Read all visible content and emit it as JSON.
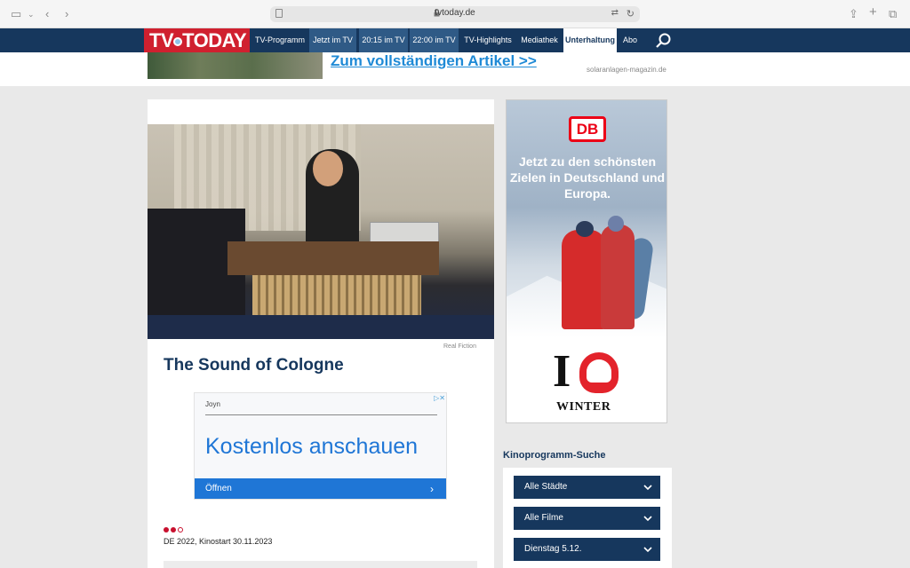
{
  "browser": {
    "url": "tvtoday.de"
  },
  "site": {
    "logo_text": "TV TODAY",
    "nav": [
      "TV-Programm",
      "Jetzt im TV",
      "20:15 im TV",
      "22:00 im TV",
      "TV-Highlights",
      "Mediathek",
      "Unterhaltung",
      "Abo"
    ],
    "active_nav": "Unterhaltung"
  },
  "top_ad": {
    "headline": "Zum vollständigen Artikel >>",
    "source": "solaranlagen-magazin.de"
  },
  "article": {
    "image_credit": "Real Fiction",
    "title": "The Sound of Cologne",
    "meta": "DE 2022, Kinostart 30.11.2023",
    "rating_filled": 2,
    "rating_total": 3
  },
  "joyn_ad": {
    "brand": "Joyn",
    "cta": "Kostenlos anschauen",
    "button": "Öffnen"
  },
  "db_ad": {
    "logo": "DB",
    "text": "Jetzt zu den schönsten Zielen in Deutschland und Europa.",
    "tagline": "WINTER"
  },
  "kino": {
    "heading": "Kinoprogramm-Suche",
    "selects": [
      "Alle Städte",
      "Alle Filme",
      "Dienstag 5.12."
    ]
  },
  "colors": {
    "nav_bg": "#16375d",
    "logo_red": "#d0202f",
    "link_blue": "#1f8ad6",
    "db_red": "#ec0016"
  }
}
